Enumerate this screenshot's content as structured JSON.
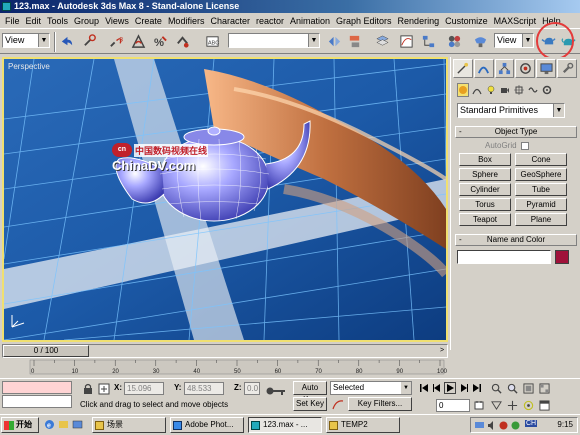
{
  "window": {
    "title": "123.max - Autodesk 3ds Max 8  - Stand-alone License"
  },
  "menu": [
    "File",
    "Edit",
    "Tools",
    "Group",
    "Views",
    "Create",
    "Modifiers",
    "Character",
    "reactor",
    "Animation",
    "Graph Editors",
    "Rendering",
    "Customize",
    "MAXScript",
    "Help"
  ],
  "toolbar": {
    "selection_filter": "View",
    "named_selection": "",
    "ref_coord": "View",
    "icons": [
      "select-link-icon",
      "unlink-icon",
      "bind-space-warp-icon",
      "select-object-icon",
      "select-move-icon",
      "mirror-icon",
      "align-icon",
      "material-editor-icon",
      "render-scene-icon",
      "quick-render-icon",
      "teapot-icon"
    ],
    "highlight_color": "#e43a3a"
  },
  "viewport": {
    "label": "Perspective",
    "watermark_logo": "cn",
    "watermark_cn": "中国数码视频在线",
    "watermark_url": "ChinaDV.com",
    "frame_color": "#f0e070"
  },
  "command_panel": {
    "tabs": [
      "create-tab-icon",
      "modify-tab-icon",
      "hierarchy-tab-icon",
      "motion-tab-icon",
      "display-tab-icon",
      "utilities-tab-icon"
    ],
    "categories": [
      "geometry-icon",
      "shapes-icon",
      "lights-icon",
      "cameras-icon",
      "helpers-icon",
      "space-warps-icon",
      "systems-icon"
    ],
    "dropdown": "Standard Primitives",
    "object_type_title": "Object Type",
    "autogrid": "AutoGrid",
    "primitives": [
      "Box",
      "Cone",
      "Sphere",
      "GeoSphere",
      "Cylinder",
      "Tube",
      "Torus",
      "Pyramid",
      "Teapot",
      "Plane"
    ],
    "name_color_title": "Name and Color",
    "rollout_toggle": "-",
    "object_color": "#a0123a"
  },
  "timeline": {
    "slider_label": "0 / 100",
    "ticks": [
      "0",
      "10",
      "20",
      "30",
      "40",
      "50",
      "60",
      "70",
      "80",
      "90",
      "100"
    ]
  },
  "status": {
    "x_label": "X:",
    "x_value": "15.096",
    "y_label": "Y:",
    "y_value": "48.533",
    "z_label": "Z:",
    "z_value": "0.0",
    "prompt": "Click and drag to select and move objects",
    "auto_key": "Auto Key",
    "set_key": "Set Key",
    "selected": "Selected",
    "key_filters": "Key Filters...",
    "frame": "0"
  },
  "taskbar": {
    "start": "开始",
    "tasks": [
      "场景",
      "Adobe Phot...",
      "123.max - ...",
      "TEMP2"
    ],
    "tray_ime": "CH",
    "clock": "9:15"
  }
}
